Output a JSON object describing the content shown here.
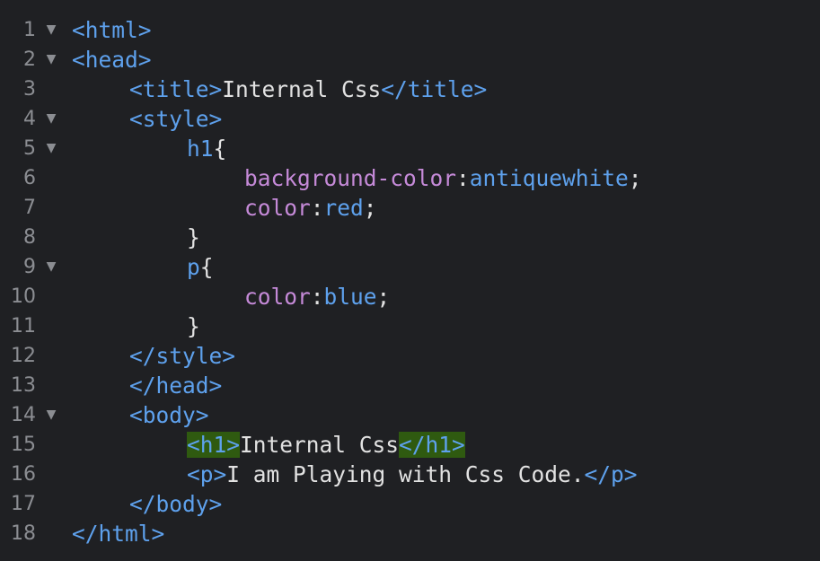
{
  "editor": {
    "fold_glyph": "▼",
    "lines": [
      {
        "num": "1",
        "fold": true,
        "indent": 0,
        "tokens": [
          {
            "t": "<html>",
            "k": "tag"
          }
        ]
      },
      {
        "num": "2",
        "fold": true,
        "indent": 0,
        "tokens": [
          {
            "t": "<head>",
            "k": "tag"
          }
        ]
      },
      {
        "num": "3",
        "fold": false,
        "indent": 1,
        "tokens": [
          {
            "t": "<title>",
            "k": "tag"
          },
          {
            "t": "Internal Css",
            "k": "text"
          },
          {
            "t": "</title>",
            "k": "tag"
          }
        ]
      },
      {
        "num": "4",
        "fold": true,
        "indent": 1,
        "tokens": [
          {
            "t": "<style>",
            "k": "tag"
          }
        ]
      },
      {
        "num": "5",
        "fold": true,
        "indent": 2,
        "tokens": [
          {
            "t": "h1",
            "k": "sel"
          },
          {
            "t": "{",
            "k": "punct"
          }
        ]
      },
      {
        "num": "6",
        "fold": false,
        "indent": 3,
        "tokens": [
          {
            "t": "background-color",
            "k": "prop"
          },
          {
            "t": ":",
            "k": "punct"
          },
          {
            "t": "antiquewhite",
            "k": "val"
          },
          {
            "t": ";",
            "k": "punct"
          }
        ]
      },
      {
        "num": "7",
        "fold": false,
        "indent": 3,
        "tokens": [
          {
            "t": "color",
            "k": "prop"
          },
          {
            "t": ":",
            "k": "punct"
          },
          {
            "t": "red",
            "k": "val"
          },
          {
            "t": ";",
            "k": "punct"
          }
        ]
      },
      {
        "num": "8",
        "fold": false,
        "indent": 2,
        "tokens": [
          {
            "t": "}",
            "k": "punct"
          }
        ]
      },
      {
        "num": "9",
        "fold": true,
        "indent": 2,
        "tokens": [
          {
            "t": "p",
            "k": "sel"
          },
          {
            "t": "{",
            "k": "punct"
          }
        ]
      },
      {
        "num": "10",
        "fold": false,
        "indent": 3,
        "tokens": [
          {
            "t": "color",
            "k": "prop"
          },
          {
            "t": ":",
            "k": "punct"
          },
          {
            "t": "blue",
            "k": "val"
          },
          {
            "t": ";",
            "k": "punct"
          }
        ]
      },
      {
        "num": "11",
        "fold": false,
        "indent": 2,
        "tokens": [
          {
            "t": "}",
            "k": "punct"
          }
        ]
      },
      {
        "num": "12",
        "fold": false,
        "indent": 1,
        "tokens": [
          {
            "t": "</style>",
            "k": "tag"
          }
        ]
      },
      {
        "num": "13",
        "fold": false,
        "indent": 1,
        "tokens": [
          {
            "t": "</head>",
            "k": "tag"
          }
        ]
      },
      {
        "num": "14",
        "fold": true,
        "indent": 1,
        "tokens": [
          {
            "t": "<body>",
            "k": "tag"
          }
        ]
      },
      {
        "num": "15",
        "fold": false,
        "indent": 2,
        "tokens": [
          {
            "t": "<h1>",
            "k": "tag",
            "match": true
          },
          {
            "t": "Internal Css",
            "k": "text"
          },
          {
            "t": "</h1>",
            "k": "tag",
            "match": true
          }
        ]
      },
      {
        "num": "16",
        "fold": false,
        "indent": 2,
        "tokens": [
          {
            "t": "<p>",
            "k": "tag"
          },
          {
            "t": "I am Playing with Css Code.",
            "k": "text"
          },
          {
            "t": "</p>",
            "k": "tag"
          }
        ]
      },
      {
        "num": "17",
        "fold": false,
        "indent": 1,
        "tokens": [
          {
            "t": "</body>",
            "k": "tag"
          }
        ]
      },
      {
        "num": "18",
        "fold": false,
        "indent": 0,
        "tokens": [
          {
            "t": "</html>",
            "k": "tag"
          }
        ]
      }
    ]
  }
}
